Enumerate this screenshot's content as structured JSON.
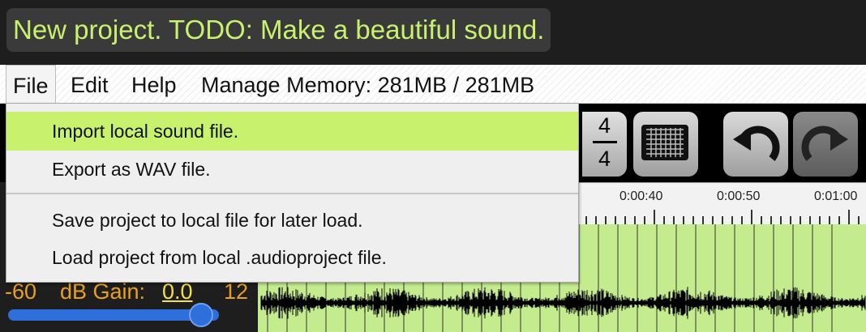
{
  "title": "New project. TODO: Make a beautiful sound.",
  "menubar": {
    "file": "File",
    "edit": "Edit",
    "help": "Help",
    "memory": "Manage Memory: 281MB / 281MB"
  },
  "file_menu": {
    "items": [
      {
        "label": "Import local sound file."
      },
      {
        "label": "Export as WAV file."
      },
      {
        "label": "Save project to local file for later load."
      },
      {
        "label": "Load project from local .audioproject file."
      }
    ]
  },
  "toolbar": {
    "time_signature_top": "4",
    "time_signature_bottom": "4",
    "buttons": [
      "grid-icon",
      "undo-icon",
      "redo-icon"
    ]
  },
  "timeline": {
    "labels": [
      "0:00:40",
      "0:00:50",
      "0:01:00"
    ]
  },
  "gain": {
    "min": "-60",
    "label": "dB Gain:",
    "value": "0.0",
    "max": "12",
    "slider_fraction": 0.83
  },
  "colors": {
    "accent": "#c8f26e",
    "waveform_bg": "#c4ec8e",
    "gain_text": "#e8a020",
    "slider": "#2f6fdc"
  }
}
